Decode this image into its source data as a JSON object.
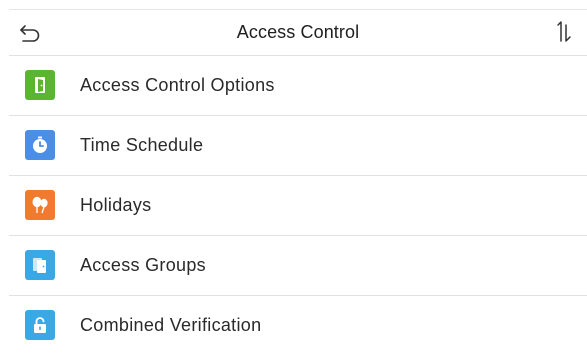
{
  "header": {
    "title": "Access Control",
    "back_icon": "back-arrow-icon",
    "sort_icon": "sort-icon"
  },
  "menu": {
    "items": [
      {
        "label": "Access Control Options",
        "icon": "door-exit-icon",
        "color": "#5cb531"
      },
      {
        "label": "Time Schedule",
        "icon": "clock-icon",
        "color": "#4a8ee6"
      },
      {
        "label": "Holidays",
        "icon": "balloons-icon",
        "color": "#f07b2f"
      },
      {
        "label": "Access Groups",
        "icon": "doors-icon",
        "color": "#3aa8e4"
      },
      {
        "label": "Combined Verification",
        "icon": "padlock-icon",
        "color": "#3aa8e4"
      }
    ]
  }
}
